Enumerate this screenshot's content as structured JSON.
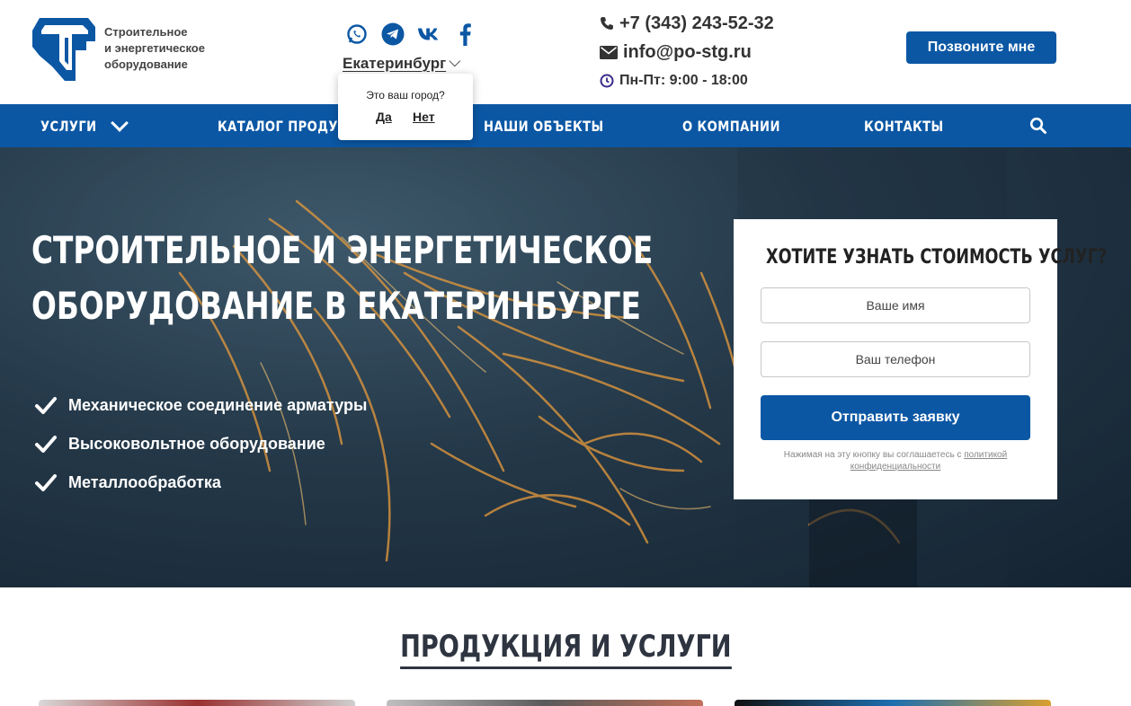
{
  "header": {
    "logo_text_lines": [
      "Строительное",
      "и энергетическое",
      "оборудование"
    ],
    "socials": [
      "whatsapp-icon",
      "telegram-icon",
      "vk-icon",
      "facebook-icon"
    ],
    "city": "Екатеринбург",
    "city_popup": {
      "question": "Это ваш город?",
      "yes": "Да",
      "no": "Нет"
    },
    "phone": "+7 (343) 243-52-32",
    "email": "info@po-stg.ru",
    "hours": "Пн-Пт: 9:00 - 18:00",
    "callback_label": "Позвоните мне"
  },
  "nav": {
    "items": [
      "УСЛУГИ",
      "КАТАЛОГ ПРОДУКЦИИ",
      "НАШИ ОБЪЕКТЫ",
      "О КОМПАНИИ",
      "КОНТАКТЫ"
    ]
  },
  "hero": {
    "title_lines": [
      "СТРОИТЕЛЬНОЕ И ЭНЕРГЕТИЧЕСКОЕ",
      "ОБОРУДОВАНИЕ В ЕКАТЕРИНБУРГЕ"
    ],
    "features": [
      "Механическое соединение арматуры",
      "Высоковольтное оборудование",
      "Металлообработка"
    ]
  },
  "form": {
    "title": "ХОТИТЕ УЗНАТЬ СТОИМОСТЬ УСЛУГ?",
    "name_placeholder": "Ваше имя",
    "phone_placeholder": "Ваш телефон",
    "submit_label": "Отправить заявку",
    "policy_prefix": "Нажимая на эту кнопку вы соглашаетесь с ",
    "policy_link": "политикой конфиденциальности"
  },
  "section": {
    "title": "ПРОДУКЦИЯ И УСЛУГИ"
  },
  "colors": {
    "brand": "#0b57a4",
    "text_dark": "#2e3440"
  }
}
